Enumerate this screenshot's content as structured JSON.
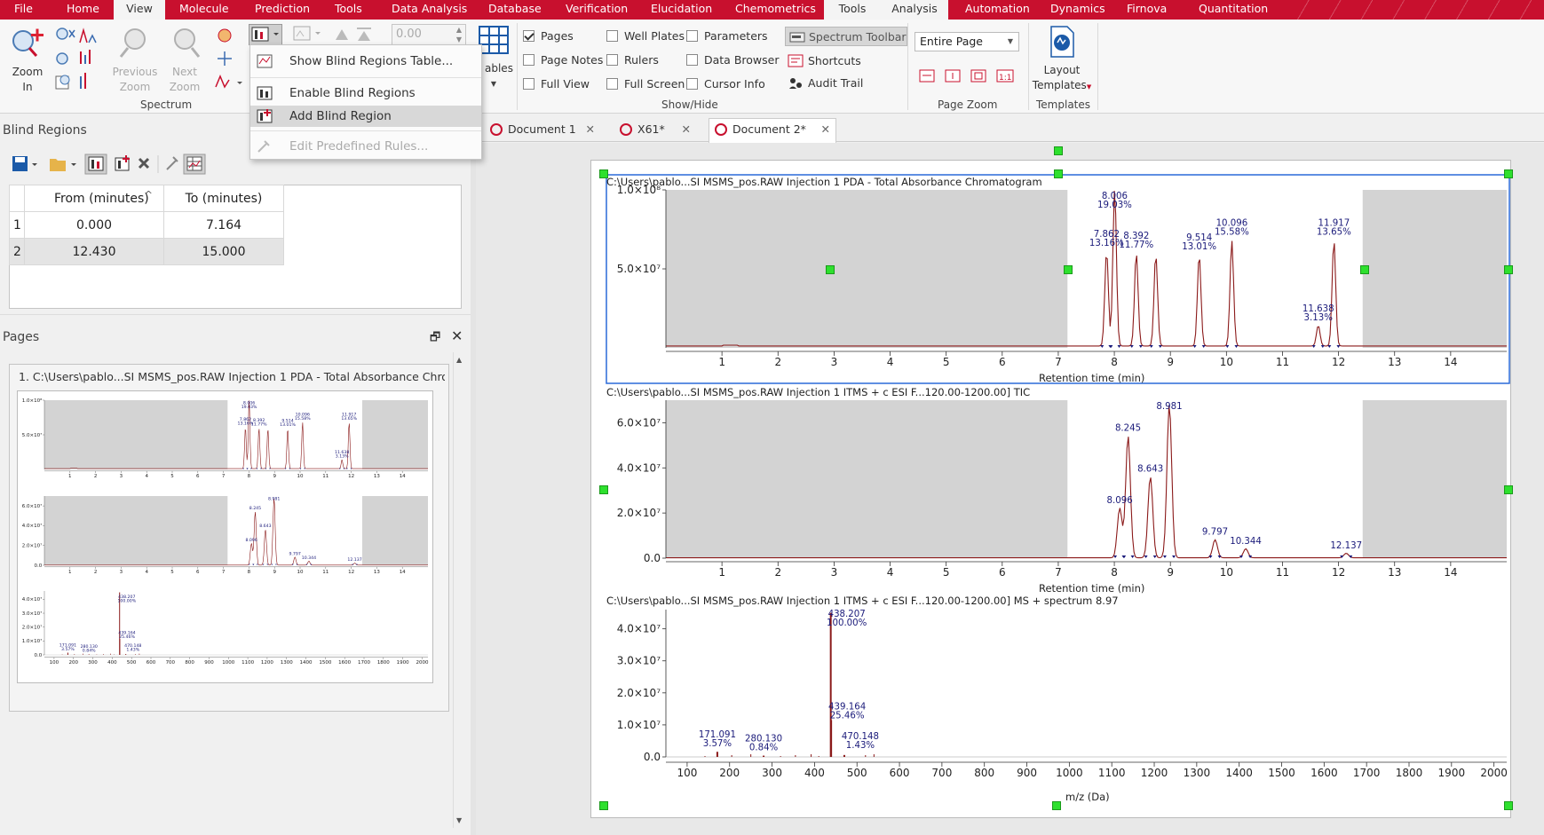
{
  "menu": {
    "items": [
      "File",
      "Home",
      "View",
      "Molecule",
      "Prediction",
      "Tools",
      "Data Analysis",
      "Database",
      "Verification",
      "Elucidation",
      "Chemometrics",
      "Tools",
      "Analysis",
      "Automation",
      "Dynamics",
      "Firnova",
      "Quantitation"
    ],
    "active": "View"
  },
  "ribbon": {
    "zoom_in": "Zoom In",
    "zoom_in_l1": "Zoom",
    "zoom_in_l2": "In",
    "prev_zoom_l1": "Previous",
    "prev_zoom_l2": "Zoom",
    "next_zoom_l1": "Next",
    "next_zoom_l2": "Zoom",
    "spectrum_group": "Spectrum",
    "numeric_value": "0.00",
    "tables_label": "ables",
    "show_hide_group": "Show/Hide",
    "checks": [
      {
        "label": "Pages",
        "checked": true
      },
      {
        "label": "Page Notes",
        "checked": false
      },
      {
        "label": "Full View",
        "checked": false
      },
      {
        "label": "Well Plates",
        "checked": false
      },
      {
        "label": "Rulers",
        "checked": false
      },
      {
        "label": "Full Screen",
        "checked": false
      },
      {
        "label": "Parameters",
        "checked": false
      },
      {
        "label": "Data Browser",
        "checked": false
      },
      {
        "label": "Cursor Info",
        "checked": false
      }
    ],
    "spectrum_toolbar": "Spectrum Toolbar",
    "shortcuts": "Shortcuts",
    "audit_trail": "Audit Trail",
    "page_zoom_value": "Entire Page",
    "page_zoom_group": "Page Zoom",
    "layout_templates_l1": "Layout",
    "layout_templates_l2": "Templates",
    "templates_group": "Templates"
  },
  "blind_menu": {
    "items": [
      "Show Blind Regions Table...",
      "Enable Blind Regions",
      "Add Blind Region",
      "Edit Predefined Rules..."
    ]
  },
  "blind_panel": {
    "title": "Blind Regions",
    "headers": [
      "From (minutes)",
      "To (minutes)"
    ],
    "rows": [
      {
        "n": "1",
        "from": "0.000",
        "to": "7.164"
      },
      {
        "n": "2",
        "from": "12.430",
        "to": "15.000"
      }
    ]
  },
  "pages_panel": {
    "title": "Pages",
    "item": "1. C:\\Users\\pablo...SI MSMS_pos.RAW Injection 1  PDA - Total Absorbance Chror"
  },
  "tabs": [
    {
      "label": "Document 1",
      "active": false
    },
    {
      "label": "X61*",
      "active": false
    },
    {
      "label": "Document 2*",
      "active": true
    }
  ],
  "plots": {
    "p1_title": "C:\\Users\\pablo...SI MSMS_pos.RAW Injection 1  PDA - Total Absorbance Chromatogram",
    "p2_title": "C:\\Users\\pablo...SI MSMS_pos.RAW Injection 1 ITMS + c ESI F...120.00-1200.00] TIC",
    "p3_title": "C:\\Users\\pablo...SI MSMS_pos.RAW Injection 1 ITMS + c ESI F...120.00-1200.00] MS + spectrum 8.97",
    "xlabel_rt": "Retention time (min)",
    "xlabel_mz": "m/z (Da)"
  },
  "chart_data": [
    {
      "type": "line",
      "title": "C:\\Users\\pablo...SI MSMS_pos.RAW Injection 1  PDA - Total Absorbance Chromatogram",
      "xlabel": "Retention time (min)",
      "xlim": [
        0,
        15
      ],
      "ylim": [
        0,
        100000000.0
      ],
      "yticks": [
        "5.0×10⁷",
        "1.0×10⁸"
      ],
      "blind_regions": [
        [
          0,
          7.164
        ],
        [
          12.43,
          15
        ]
      ],
      "peaks": [
        {
          "x": 7.862,
          "y": 60000000.0,
          "label": "7.862",
          "pct": "13.16%"
        },
        {
          "x": 8.006,
          "y": 100000000.0,
          "label": "8.006",
          "pct": "19.03%"
        },
        {
          "x": 8.392,
          "y": 59000000.0,
          "label": "8.392",
          "pct": "11.77%"
        },
        {
          "x": 8.74,
          "y": 58000000.0,
          "label": "",
          "pct": ""
        },
        {
          "x": 9.514,
          "y": 58000000.0,
          "label": "9.514",
          "pct": "13.01%"
        },
        {
          "x": 10.096,
          "y": 67000000.0,
          "label": "10.096",
          "pct": "15.58%"
        },
        {
          "x": 11.638,
          "y": 13000000.0,
          "label": "11.638",
          "pct": "3.13%"
        },
        {
          "x": 11.917,
          "y": 67000000.0,
          "label": "11.917",
          "pct": "13.65%"
        }
      ]
    },
    {
      "type": "line",
      "title": "C:\\Users\\pablo...SI MSMS_pos.RAW Injection 1 ITMS + c ESI F...120.00-1200.00] TIC",
      "xlabel": "Retention time (min)",
      "xlim": [
        0,
        15
      ],
      "ylim": [
        0,
        70000000.0
      ],
      "yticks": [
        "0.0",
        "2.0×10⁷",
        "4.0×10⁷",
        "6.0×10⁷"
      ],
      "blind_regions": [
        [
          0,
          7.164
        ],
        [
          12.43,
          15
        ]
      ],
      "peaks": [
        {
          "x": 8.096,
          "y": 22000000.0,
          "label": "8.096"
        },
        {
          "x": 8.245,
          "y": 54000000.0,
          "label": "8.245"
        },
        {
          "x": 8.643,
          "y": 36000000.0,
          "label": "8.643"
        },
        {
          "x": 8.981,
          "y": 68000000.0,
          "label": "8.981"
        },
        {
          "x": 9.797,
          "y": 8000000.0,
          "label": "9.797"
        },
        {
          "x": 10.344,
          "y": 4000000.0,
          "label": "10.344"
        },
        {
          "x": 12.137,
          "y": 2000000.0,
          "label": "12.137"
        }
      ]
    },
    {
      "type": "bar",
      "title": "C:\\Users\\pablo...SI MSMS_pos.RAW Injection 1 ITMS + c ESI F...120.00-1200.00] MS + spectrum 8.97",
      "xlabel": "m/z (Da)",
      "xlim": [
        50,
        2030
      ],
      "ylim": [
        0,
        46000000.0
      ],
      "yticks": [
        "0.0",
        "1.0×10⁷",
        "2.0×10⁷",
        "3.0×10⁷",
        "4.0×10⁷"
      ],
      "peaks": [
        {
          "x": 171.091,
          "y": 1600000.0,
          "label": "171.091",
          "pct": "3.57%"
        },
        {
          "x": 280.13,
          "y": 400000.0,
          "label": "280.130",
          "pct": "0.84%"
        },
        {
          "x": 438.207,
          "y": 45000000.0,
          "label": "438.207",
          "pct": "100.00%"
        },
        {
          "x": 439.164,
          "y": 11500000.0,
          "label": "439.164",
          "pct": "25.46%"
        },
        {
          "x": 470.148,
          "y": 600000.0,
          "label": "470.148",
          "pct": "1.43%"
        }
      ]
    }
  ],
  "colors": {
    "brand": "#c8102e",
    "trace": "#8b1a1a",
    "label": "#1a1a7a",
    "blind": "#d3d3d3",
    "selection": "#2a6ad8",
    "handle": "#2ee02e"
  }
}
